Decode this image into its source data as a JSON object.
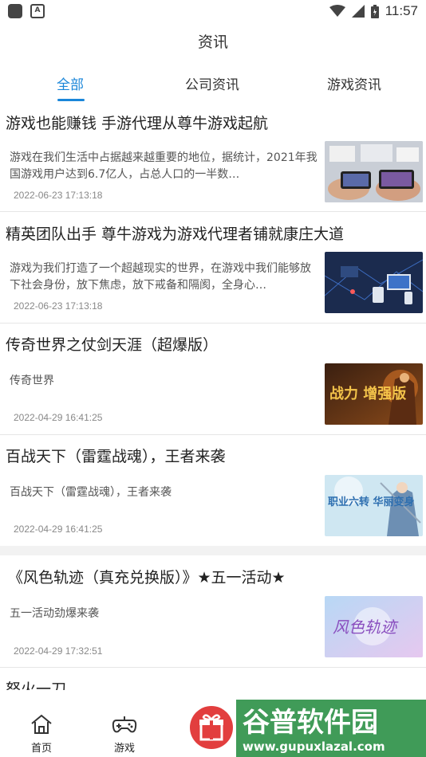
{
  "status_bar": {
    "time": "11:57"
  },
  "header": {
    "title": "资讯"
  },
  "tabs": [
    {
      "label": "全部",
      "active": true
    },
    {
      "label": "公司资讯",
      "active": false
    },
    {
      "label": "游戏资讯",
      "active": false
    }
  ],
  "news": [
    {
      "title": "游戏也能赚钱 手游代理从尊牛游戏起航",
      "summary": "游戏在我们生活中占据越来越重要的地位，据统计，2021年我国游戏用户达到6.7亿人，占总人口的一半数…",
      "date": "2022-06-23 17:13:18",
      "thumb": "hands-phones-image"
    },
    {
      "title": "精英团队出手 尊牛游戏为游戏代理者铺就康庄大道",
      "summary": "游戏为我们打造了一个超越现实的世界，在游戏中我们能够放下社会身份，放下焦虑，放下戒备和隔阂，全身心…",
      "date": "2022-06-23 17:13:18",
      "thumb": "network-devices-image"
    },
    {
      "title": "传奇世界之仗剑天涯（超爆版）",
      "summary": "传奇世界",
      "date": "2022-04-29 16:41:25",
      "thumb": "warrior-banner-image"
    },
    {
      "title": "百战天下（雷霆战魂），王者来袭",
      "summary": "百战天下（雷霆战魂），王者来袭",
      "date": "2022-04-29 16:41:25",
      "thumb": "swordsman-banner-image"
    },
    {
      "title": "《风色轨迹（真充兑换版）》★五一活动★",
      "summary": "五一活动劲爆来袭",
      "date": "2022-04-29 17:32:51",
      "thumb": "fengse-logo-image"
    },
    {
      "title": "怒火一刀",
      "summary": "",
      "date": "",
      "thumb": ""
    }
  ],
  "thumb_text": {
    "warrior": "战力 增强版",
    "swordsman": "职业六转 华丽变身",
    "fengse": "风色轨迹"
  },
  "bottom_nav": [
    {
      "label": "首页",
      "icon": "home-icon"
    },
    {
      "label": "游戏",
      "icon": "gamepad-icon"
    }
  ],
  "watermark": {
    "title": "谷普软件园",
    "url": "www.gupuxlazal.com"
  },
  "colors": {
    "accent": "#1a86d9",
    "gift": "#e23e3e"
  }
}
